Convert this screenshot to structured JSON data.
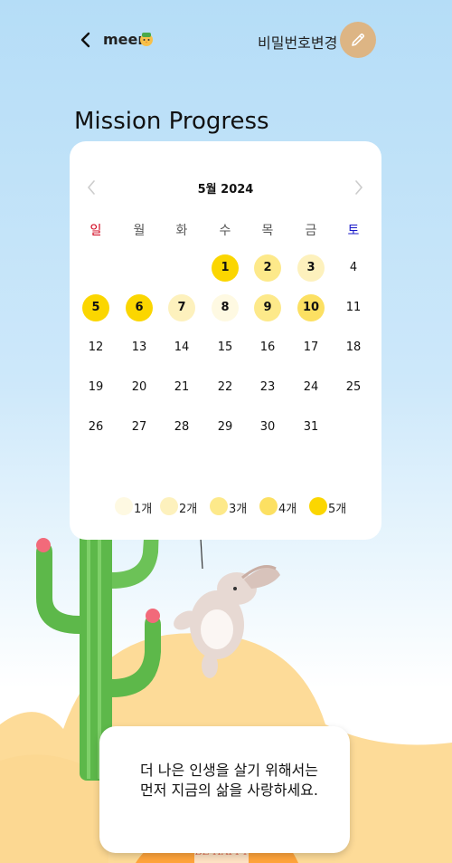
{
  "header": {
    "username": "meer",
    "password_change_label": "비밀번호변경"
  },
  "page": {
    "title": "Mission Progress"
  },
  "calendar": {
    "month_label": "5월 2024",
    "weekdays": [
      "일",
      "월",
      "화",
      "수",
      "목",
      "금",
      "토"
    ],
    "first_weekday_index": 3,
    "days_in_month": 31,
    "mission_levels": {
      "1": 5,
      "2": 3,
      "3": 2,
      "5": 5,
      "6": 5,
      "7": 2,
      "8": 1,
      "9": 3,
      "10": 4
    },
    "legend": [
      {
        "label": "1개",
        "color": "#fef9e2"
      },
      {
        "label": "2개",
        "color": "#fdf1bd"
      },
      {
        "label": "3개",
        "color": "#fde98a"
      },
      {
        "label": "4개",
        "color": "#fce062"
      },
      {
        "label": "5개",
        "color": "#fbd600"
      }
    ]
  },
  "quote": {
    "text": "더 나은 인생을 살기 위해서는 먼저 지금의 삶을 사랑하세요."
  },
  "illustration": {
    "banner_text": "BE HAPPY"
  },
  "colors": {
    "edit_button": "#ddb584",
    "sunday": "#d0021b",
    "saturday": "#1a1ac8"
  }
}
